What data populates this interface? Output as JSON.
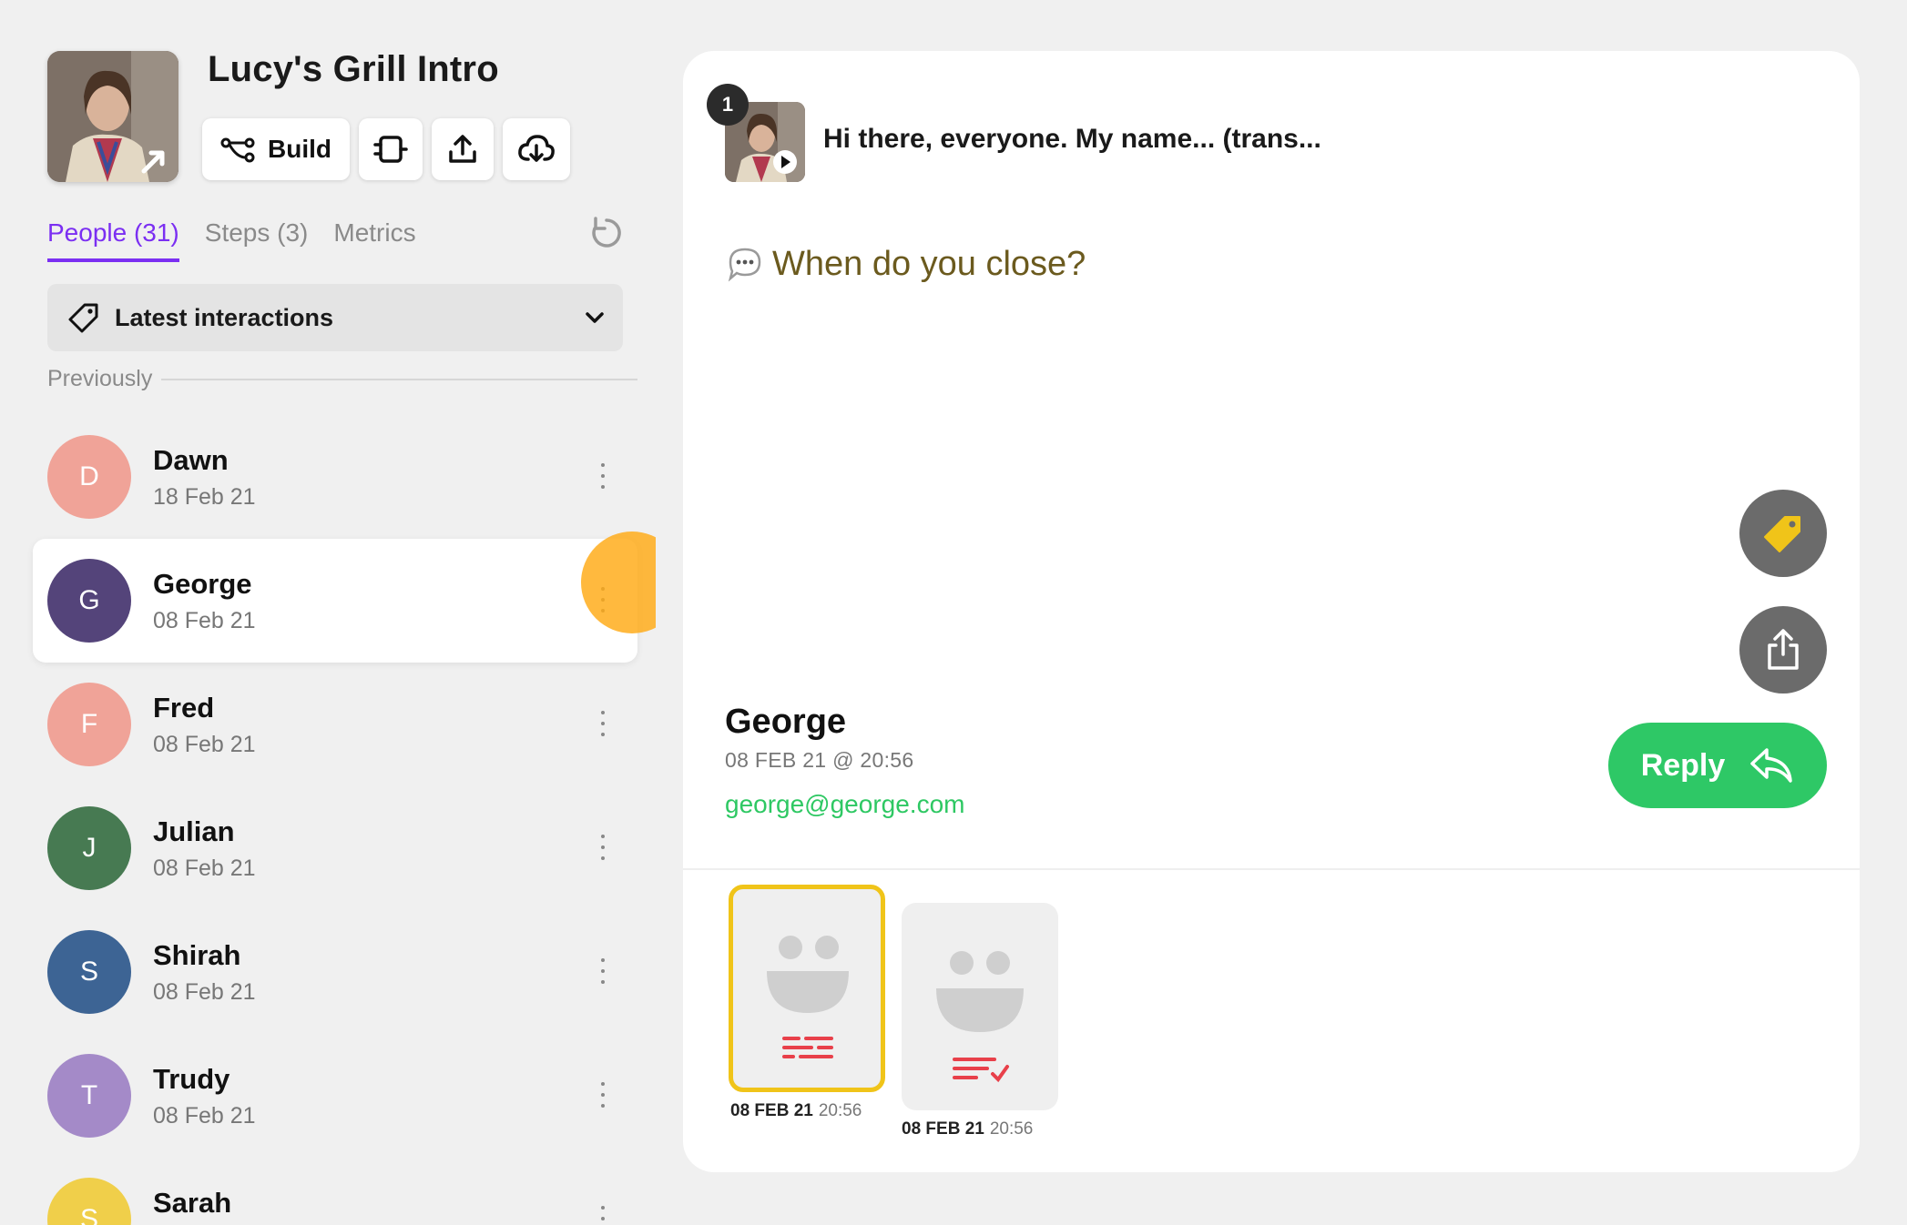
{
  "project": {
    "title": "Lucy's Grill Intro",
    "build_label": "Build"
  },
  "tabs": [
    {
      "label": "People (31)",
      "active": true
    },
    {
      "label": "Steps (3)",
      "active": false
    },
    {
      "label": "Metrics",
      "active": false
    }
  ],
  "filter": {
    "label": "Latest interactions"
  },
  "section": {
    "label": "Previously"
  },
  "people": [
    {
      "initial": "D",
      "name": "Dawn",
      "date": "18 Feb 21",
      "color": "#f0a398",
      "selected": false
    },
    {
      "initial": "G",
      "name": "George",
      "date": "08 Feb 21",
      "color": "#54447a",
      "selected": true
    },
    {
      "initial": "F",
      "name": "Fred",
      "date": "08 Feb 21",
      "color": "#f0a398",
      "selected": false
    },
    {
      "initial": "J",
      "name": "Julian",
      "date": "08 Feb 21",
      "color": "#477a52",
      "selected": false
    },
    {
      "initial": "S",
      "name": "Shirah",
      "date": "08 Feb 21",
      "color": "#3d6494",
      "selected": false
    },
    {
      "initial": "T",
      "name": "Trudy",
      "date": "08 Feb 21",
      "color": "#a48ac8",
      "selected": false
    },
    {
      "initial": "S",
      "name": "Sarah",
      "date": "",
      "color": "#f0cf4a",
      "selected": false
    }
  ],
  "step": {
    "number": "1",
    "text": "Hi there, everyone. My name... (trans..."
  },
  "question": {
    "text": "When do you close?"
  },
  "response": {
    "name": "George",
    "datetime": "08 FEB 21 @ 20:56",
    "email": "george@george.com",
    "reply_label": "Reply"
  },
  "response_tiles": [
    {
      "date": "08 FEB 21",
      "time": "20:56",
      "selected": true
    },
    {
      "date": "08 FEB 21",
      "time": "20:56",
      "selected": false
    }
  ],
  "colors": {
    "accent_purple": "#7b2ff2",
    "reply_green": "#2ec866",
    "question_text": "#6b5a1e",
    "tag_yellow": "#f0c419",
    "transcript_red": "#e8404a"
  },
  "icons": {
    "build": "branch-icon",
    "toolbar_2": "plug-icon",
    "toolbar_3": "upload-icon",
    "toolbar_4": "cloud-download-icon",
    "refresh": "refresh-icon",
    "filter": "tag-icon",
    "dropdown": "chevron-down-icon",
    "fab_tag": "tag-icon",
    "fab_share": "share-icon",
    "reply": "reply-arrow-icon"
  }
}
